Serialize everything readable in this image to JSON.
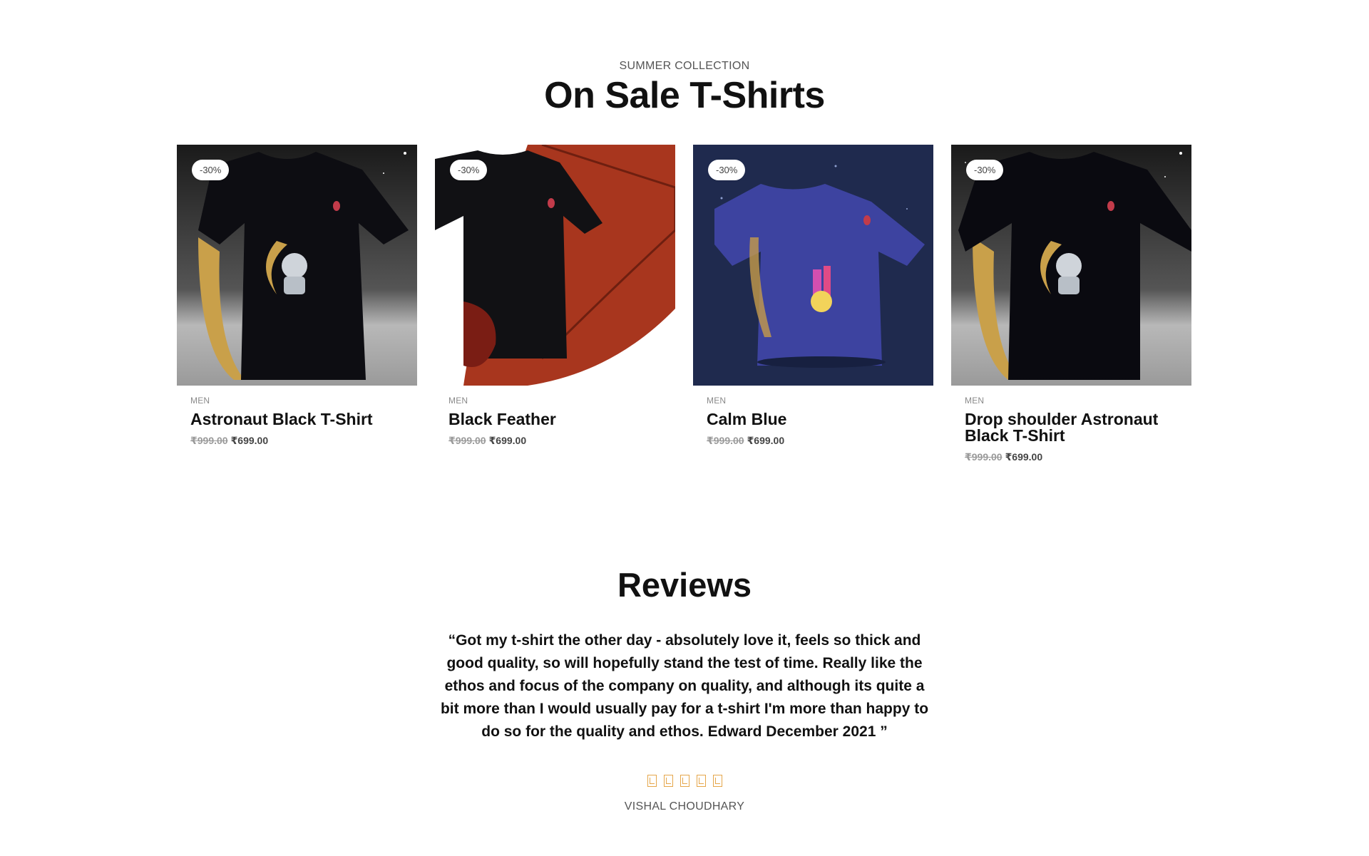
{
  "sale_section": {
    "subtitle": "SUMMER COLLECTION",
    "title": "On Sale T-Shirts"
  },
  "products": [
    {
      "badge": "-30%",
      "category": "MEN",
      "name": "Astronaut Black T-Shirt",
      "old_price": "₹999.00",
      "price": "₹699.00",
      "image_icon": "astronaut-black-tshirt"
    },
    {
      "badge": "-30%",
      "category": "MEN",
      "name": "Black Feather",
      "old_price": "₹999.00",
      "price": "₹699.00",
      "image_icon": "black-feather-tshirt"
    },
    {
      "badge": "-30%",
      "category": "MEN",
      "name": "Calm Blue",
      "old_price": "₹999.00",
      "price": "₹699.00",
      "image_icon": "calm-blue-tshirt"
    },
    {
      "badge": "-30%",
      "category": "MEN",
      "name": "Drop shoulder Astronaut Black T-Shirt",
      "old_price": "₹999.00",
      "price": "₹699.00",
      "image_icon": "drop-shoulder-astronaut-tshirt"
    }
  ],
  "reviews": {
    "title": "Reviews",
    "quote": "“Got my t-shirt the other day - absolutely love it, feels so thick and good quality, so will hopefully stand the test of time. Really like the ethos and focus of the company on quality, and although its quite a bit more than I would usually pay for a t-shirt I'm more than happy to do so for the quality and ethos. Edward December 2021 ”",
    "rating": 5,
    "reviewer": "VISHAL CHOUDHARY"
  },
  "colors": {
    "star": "#e5a64a",
    "sale_price": "#444444",
    "old_price": "#9a9a9a"
  }
}
